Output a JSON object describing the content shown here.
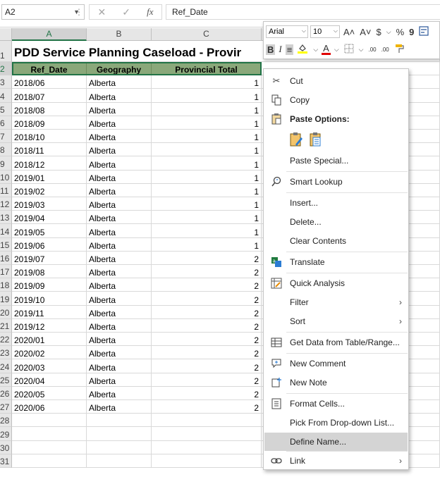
{
  "formula_bar": {
    "name_box": "A2",
    "fx_label": "fx",
    "cancel_symbol": "✕",
    "enter_symbol": "✓",
    "formula_value": "Ref_Date"
  },
  "columns": [
    "A",
    "B",
    "C"
  ],
  "rows_numbers": [
    "1",
    "2",
    "3",
    "4",
    "5",
    "6",
    "7",
    "8",
    "9",
    "10",
    "11",
    "12",
    "13",
    "14",
    "15",
    "16",
    "17",
    "18",
    "19",
    "20",
    "21",
    "22",
    "23",
    "24",
    "25",
    "26",
    "27",
    "28",
    "29",
    "30",
    "31"
  ],
  "sheet": {
    "title": "PDD Service Planning Caseload - Provir",
    "headers": [
      "Ref_Date",
      "Geography",
      "Provincial Total"
    ],
    "rows": [
      {
        "date": "2018/06",
        "geo": "Alberta",
        "total": "1"
      },
      {
        "date": "2018/07",
        "geo": "Alberta",
        "total": "1"
      },
      {
        "date": "2018/08",
        "geo": "Alberta",
        "total": "1"
      },
      {
        "date": "2018/09",
        "geo": "Alberta",
        "total": "1"
      },
      {
        "date": "2018/10",
        "geo": "Alberta",
        "total": "1"
      },
      {
        "date": "2018/11",
        "geo": "Alberta",
        "total": "1"
      },
      {
        "date": "2018/12",
        "geo": "Alberta",
        "total": "1"
      },
      {
        "date": "2019/01",
        "geo": "Alberta",
        "total": "1"
      },
      {
        "date": "2019/02",
        "geo": "Alberta",
        "total": "1"
      },
      {
        "date": "2019/03",
        "geo": "Alberta",
        "total": "1"
      },
      {
        "date": "2019/04",
        "geo": "Alberta",
        "total": "1"
      },
      {
        "date": "2019/05",
        "geo": "Alberta",
        "total": "1"
      },
      {
        "date": "2019/06",
        "geo": "Alberta",
        "total": "1"
      },
      {
        "date": "2019/07",
        "geo": "Alberta",
        "total": "2"
      },
      {
        "date": "2019/08",
        "geo": "Alberta",
        "total": "2"
      },
      {
        "date": "2019/09",
        "geo": "Alberta",
        "total": "2"
      },
      {
        "date": "2019/10",
        "geo": "Alberta",
        "total": "2"
      },
      {
        "date": "2019/11",
        "geo": "Alberta",
        "total": "2"
      },
      {
        "date": "2019/12",
        "geo": "Alberta",
        "total": "2"
      },
      {
        "date": "2020/01",
        "geo": "Alberta",
        "total": "2"
      },
      {
        "date": "2020/02",
        "geo": "Alberta",
        "total": "2"
      },
      {
        "date": "2020/03",
        "geo": "Alberta",
        "total": "2"
      },
      {
        "date": "2020/04",
        "geo": "Alberta",
        "total": "2"
      },
      {
        "date": "2020/05",
        "geo": "Alberta",
        "total": "2"
      },
      {
        "date": "2020/06",
        "geo": "Alberta",
        "total": "2"
      }
    ]
  },
  "mini_toolbar": {
    "font_name": "Arial",
    "font_size": "10",
    "grow": "A˄",
    "shrink": "A˅",
    "currency": "$",
    "percent": "%",
    "comma": "9",
    "bold": "B",
    "italic": "I",
    "font_color_letter": "A",
    "inc_decimal": ".00",
    "dec_decimal": ".00"
  },
  "context_menu": {
    "cut": "Cut",
    "copy": "Copy",
    "paste_options": "Paste Options:",
    "paste_special": "Paste Special...",
    "smart_lookup": "Smart Lookup",
    "insert": "Insert...",
    "delete": "Delete...",
    "clear_contents": "Clear Contents",
    "translate": "Translate",
    "quick_analysis": "Quick Analysis",
    "filter": "Filter",
    "sort": "Sort",
    "get_data": "Get Data from Table/Range...",
    "new_comment": "New Comment",
    "new_note": "New Note",
    "format_cells": "Format Cells...",
    "pick_list": "Pick From Drop-down List...",
    "define_name": "Define Name...",
    "link": "Link",
    "submenu_arrow": "›"
  },
  "colors": {
    "header_fill": "#8aa87a",
    "selection": "#217346",
    "menu_highlight": "#d4d4d4"
  }
}
